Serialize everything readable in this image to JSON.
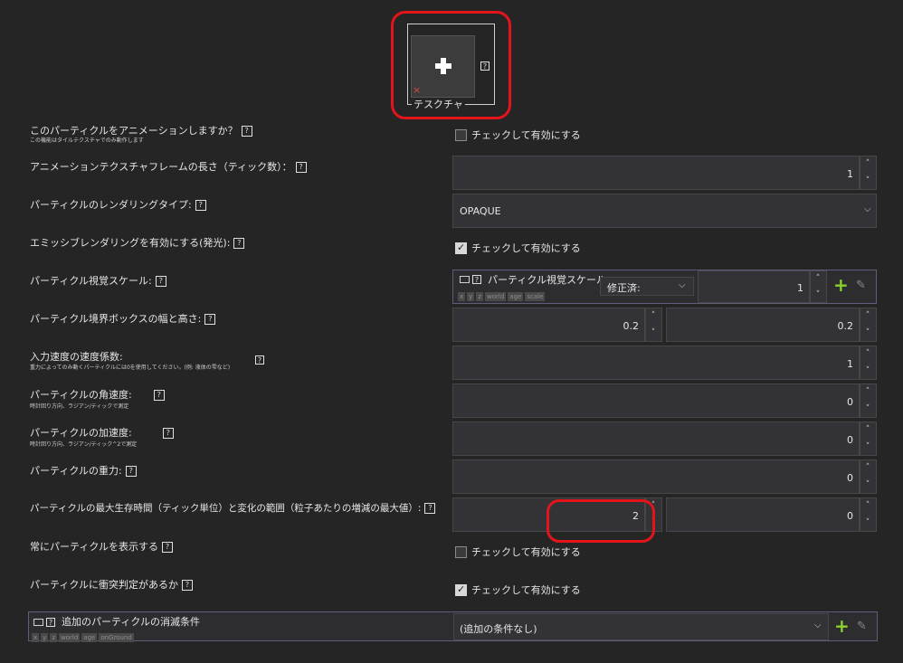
{
  "texture": {
    "label": "テスクチャ",
    "help": "?",
    "remove_glyph": "×"
  },
  "animate": {
    "label": "このパーティクルをアニメーションしますか？",
    "sublabel": "この機能はタイルテクスチャでのみ動作します",
    "check_label": "チェックして有効にする",
    "checked": false
  },
  "frame_length": {
    "label": "アニメーションテクスチャフレームの長さ（ティック数）：",
    "value": "1"
  },
  "render_type": {
    "label": "パーティクルのレンダリングタイプ:",
    "selected": "OPAQUE"
  },
  "emissive": {
    "label": "エミッシブレンダリングを有効にする(発光):",
    "check_label": "チェックして有効にする",
    "checked": true
  },
  "visual_scale": {
    "label": "パーティクル視覚スケール:",
    "panel_title": "パーティクル視覚スケール:",
    "tags": [
      "x",
      "y",
      "z",
      "world",
      "age",
      "scale"
    ],
    "modifier": "修正済:",
    "value": "1"
  },
  "bbox": {
    "label": "パーティクル境界ボックスの幅と高さ:",
    "width": "0.2",
    "height": "0.2"
  },
  "speed_factor": {
    "label": "入力速度の速度係数:",
    "sublabel": "重力によってのみ動くパーティクルには0を使用してください。(例: 液体の雫など)",
    "value": "1"
  },
  "angular_velocity": {
    "label": "パーティクルの角速度:",
    "sublabel": "時計回り方向、ラジアン/ティックで測定",
    "value": "0"
  },
  "angular_accel": {
    "label": "パーティクルの加速度:",
    "sublabel": "時計回り方向、ラジアン/ティック^2で測定",
    "value": "0"
  },
  "gravity": {
    "label": "パーティクルの重力:",
    "value": "0"
  },
  "lifetime": {
    "label": "パーティクルの最大生存時間（ティック単位）と変化の範囲（粒子あたりの増減の最大値）:",
    "max_age": "2",
    "range": "0"
  },
  "always_show": {
    "label": "常にパーティクルを表示する",
    "check_label": "チェックして有効にする",
    "checked": false
  },
  "collision": {
    "label": "パーティクルに衝突判定があるか",
    "check_label": "チェックして有効にする",
    "checked": true
  },
  "expire": {
    "panel_title": "追加のパーティクルの消滅条件",
    "tags": [
      "x",
      "y",
      "z",
      "world",
      "age",
      "onGround"
    ],
    "selected": "(追加の条件なし)"
  },
  "icons": {
    "help": "?",
    "up": "˄",
    "down": "˅",
    "chevron": "⌵",
    "plus": "+",
    "pencil": "✎"
  },
  "colors": {
    "background": "#252526",
    "field": "#333337",
    "highlight": "#e4141b",
    "add_green": "#8ad12f"
  }
}
